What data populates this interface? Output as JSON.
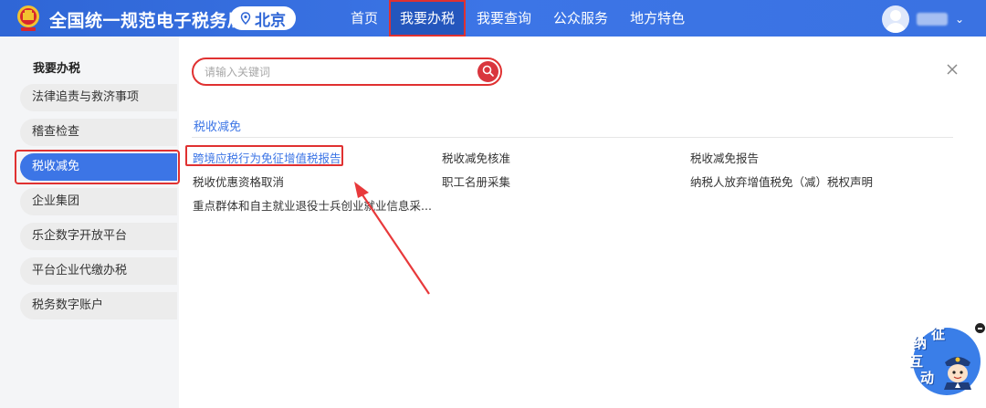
{
  "header": {
    "site_title": "全国统一规范电子税务局",
    "city": "北京",
    "nav": [
      "首页",
      "我要办税",
      "我要查询",
      "公众服务",
      "地方特色"
    ],
    "active_nav_index": 1
  },
  "search": {
    "placeholder": "请输入关键词"
  },
  "sidebar": {
    "heading": "我要办税",
    "items": [
      {
        "label": "法律追责与救济事项"
      },
      {
        "label": "稽查检查"
      },
      {
        "label": "税收减免"
      },
      {
        "label": "企业集团"
      },
      {
        "label": "乐企数字开放平台"
      },
      {
        "label": "平台企业代缴办税"
      },
      {
        "label": "税务数字账户"
      }
    ],
    "active_index": 2
  },
  "main": {
    "section_title": "税收减免",
    "links": [
      {
        "label": "跨境应税行为免征增值税报告"
      },
      {
        "label": "税收减免核准"
      },
      {
        "label": "税收减免报告"
      },
      {
        "label": "税收优惠资格取消"
      },
      {
        "label": "职工名册采集"
      },
      {
        "label": "纳税人放弃增值税免（减）税权声明"
      },
      {
        "label": "重点群体和自主就业退役士兵创业就业信息采..."
      }
    ]
  },
  "widget": {
    "chars": [
      "征",
      "纳",
      "互",
      "动"
    ]
  },
  "colors": {
    "header": "#3c75e6",
    "accent": "#3c75e6",
    "highlight_outline": "#e03131",
    "search_button": "#d9363e"
  }
}
